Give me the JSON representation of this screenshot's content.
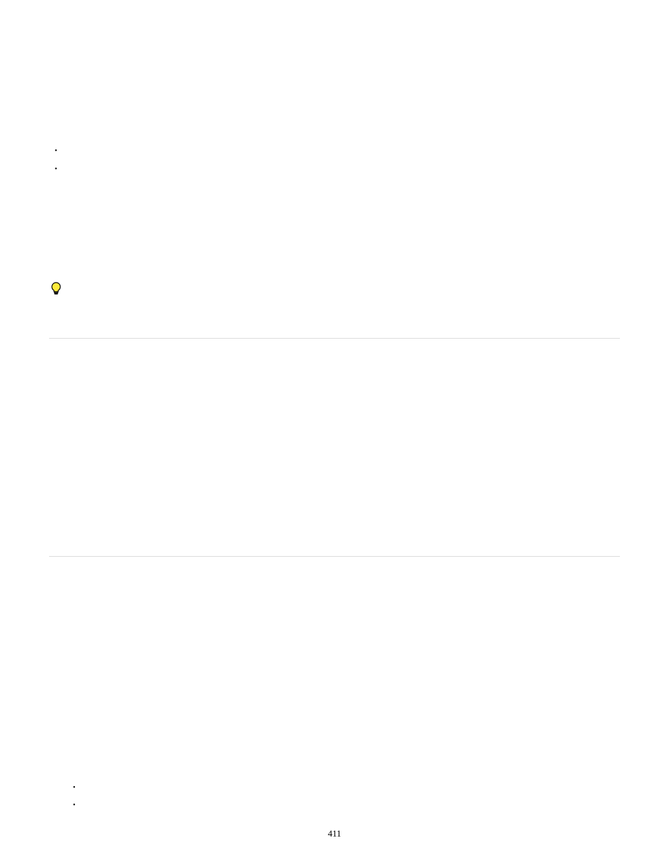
{
  "topBullets": {
    "items": [
      "",
      ""
    ]
  },
  "bottomBullets": {
    "items": [
      "",
      ""
    ]
  },
  "tip": {
    "iconName": "lightbulb-icon"
  },
  "pageNumber": "411"
}
